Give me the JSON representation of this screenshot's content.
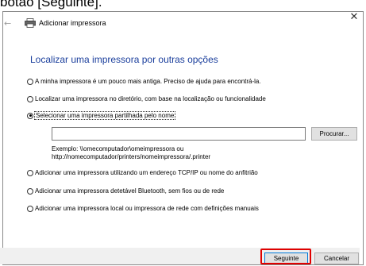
{
  "caption": "botão [Seguinte].",
  "window": {
    "header_title": "Adicionar impressora",
    "close_glyph": "✕",
    "back_glyph": "←"
  },
  "section_title": "Localizar uma impressora por outras opções",
  "options": [
    {
      "label": "A minha impressora é um pouco mais antiga. Preciso de ajuda para encontrá-la.",
      "checked": false
    },
    {
      "label": "Localizar uma impressora no diretório, com base na localização ou funcionalidade",
      "checked": false
    },
    {
      "label": "Selecionar uma impressora partilhada pelo nome",
      "checked": true
    },
    {
      "label": "Adicionar uma impressora utilizando um endereço TCP/IP ou nome do anfitrião",
      "checked": false
    },
    {
      "label": "Adicionar uma impressora detetável Bluetooth, sem fios ou de rede",
      "checked": false
    },
    {
      "label": "Adicionar uma impressora local ou impressora de rede com definições manuais",
      "checked": false
    }
  ],
  "share_input": {
    "value": ""
  },
  "browse_label": "Procurar...",
  "example_line1": "Exemplo: \\\\omecomputador\\omeimpressora ou",
  "example_line2": "http://nomecomputador/printers/nomeimpressora/.printer",
  "buttons": {
    "next_label": "Seguinte",
    "cancel_label": "Cancelar"
  },
  "colors": {
    "title_blue": "#1a3e9c",
    "highlight_red": "#e00000",
    "button_border_blue": "#0078d7"
  }
}
